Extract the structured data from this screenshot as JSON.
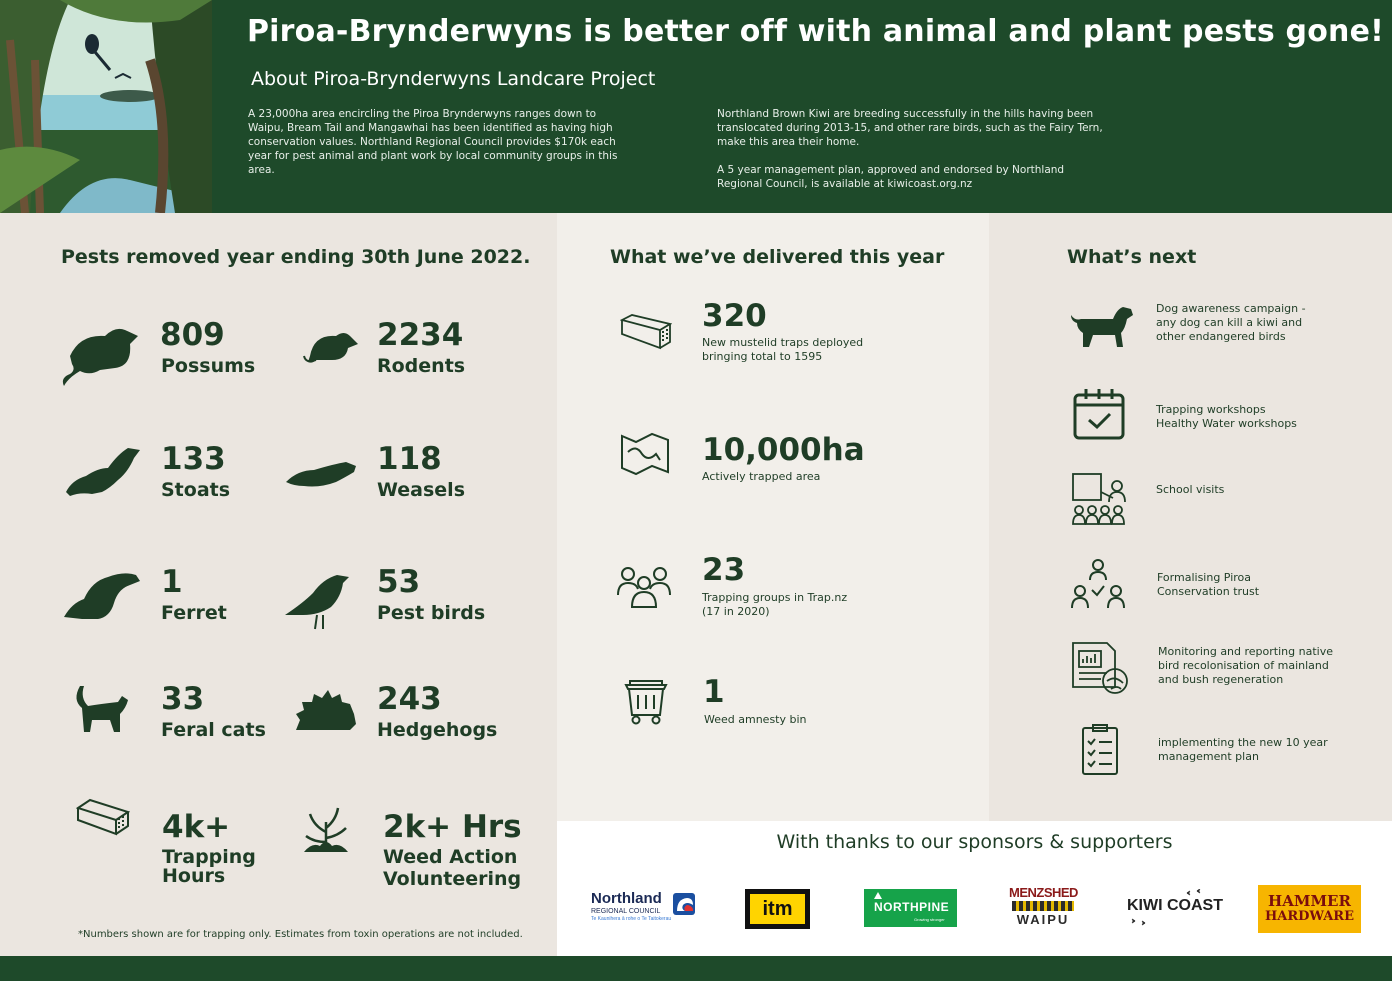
{
  "header": {
    "title": "Piroa-Brynderwyns is better off with animal and plant pests gone!",
    "subtitle": "About Piroa-Brynderwyns Landcare Project",
    "intro_left": "A 23,000ha area encircling the Piroa Brynderwyns ranges down to Waipu, Bream Tail and Mangawhai has been identified as having high conservation values. Northland Regional Council provides $170k each year for pest animal and plant work by local community groups in this area.",
    "intro_right_1": "Northland Brown Kiwi are breeding successfully in the hills having been translocated during 2013-15, and other rare birds, such as the Fairy Tern, make this area their home.",
    "intro_right_2": "A 5 year management plan, approved and endorsed by Northland Regional Council, is available at kiwicoast.org.nz"
  },
  "pests": {
    "title": "Pests removed year ending 30th June 2022.",
    "items": [
      {
        "value": "809",
        "label": "Possums",
        "icon": "possum-icon"
      },
      {
        "value": "2234",
        "label": "Rodents",
        "icon": "rodent-icon"
      },
      {
        "value": "133",
        "label": "Stoats",
        "icon": "stoat-icon"
      },
      {
        "value": "118",
        "label": "Weasels",
        "icon": "weasel-icon"
      },
      {
        "value": "1",
        "label": "Ferret",
        "icon": "ferret-icon"
      },
      {
        "value": "53",
        "label": "Pest birds",
        "icon": "bird-icon"
      },
      {
        "value": "33",
        "label": "Feral cats",
        "icon": "cat-icon"
      },
      {
        "value": "243",
        "label": "Hedgehogs",
        "icon": "hedgehog-icon"
      },
      {
        "value": "4k+",
        "label": "Trapping",
        "label2": "Hours",
        "icon": "trap-icon"
      },
      {
        "value": "2k+ Hrs",
        "label": "Weed Action",
        "label2": "Volunteering",
        "icon": "weed-icon"
      }
    ],
    "footnote": "*Numbers shown are for trapping only. Estimates from toxin operations are not included."
  },
  "delivered": {
    "title": "What we’ve delivered this year",
    "items": [
      {
        "value": "320",
        "line1": "New mustelid traps deployed",
        "line2": "bringing total to 1595",
        "icon": "trap-box-icon"
      },
      {
        "value": "10,000ha",
        "line1": "Actively trapped area",
        "line2": "",
        "icon": "map-icon"
      },
      {
        "value": "23",
        "line1": "Trapping groups in Trap.nz",
        "line2": "(17 in 2020)",
        "icon": "group-icon"
      },
      {
        "value": "1",
        "line1": "Weed amnesty bin",
        "line2": "",
        "icon": "bin-icon"
      }
    ]
  },
  "next": {
    "title": "What’s next",
    "items": [
      {
        "lines": [
          "Dog awareness campaign -",
          "any dog can kill a kiwi and",
          "other endangered birds"
        ],
        "icon": "dog-icon"
      },
      {
        "lines": [
          "Trapping workshops",
          "Healthy Water workshops"
        ],
        "icon": "calendar-icon"
      },
      {
        "lines": [
          "School visits"
        ],
        "icon": "classroom-icon"
      },
      {
        "lines": [
          "Formalising  Piroa",
          "Conservation trust"
        ],
        "icon": "team-icon"
      },
      {
        "lines": [
          "Monitoring and reporting native",
          "bird recolonisation of mainland",
          "and bush regeneration"
        ],
        "icon": "report-icon"
      },
      {
        "lines": [
          "implementing the new 10 year",
          "management plan"
        ],
        "icon": "checklist-icon"
      }
    ]
  },
  "sponsors": {
    "title": "With thanks to our sponsors & supporters",
    "logos": {
      "northland_1": "Northland",
      "northland_2": "REGIONAL COUNCIL",
      "northland_3": "Te Kaunihera ā rohe o Te Taitokerau",
      "itm": "itm",
      "northpine": "NORTHPINE",
      "northpine_tag": "Growing stronger",
      "menzshed_1": "MENZSHED",
      "menzshed_2": "WAIPU",
      "kiwicoast": "KIWI COAST",
      "hammer_1": "HAMMER",
      "hammer_2": "HARDWARE"
    }
  },
  "colors": {
    "dark_green": "#1e4a2a",
    "text_green": "#1f3d26",
    "beige": "#ebe6e0",
    "light_beige": "#f2efea",
    "hammer_yellow": "#f7b500",
    "northpine_green": "#16a34a"
  }
}
